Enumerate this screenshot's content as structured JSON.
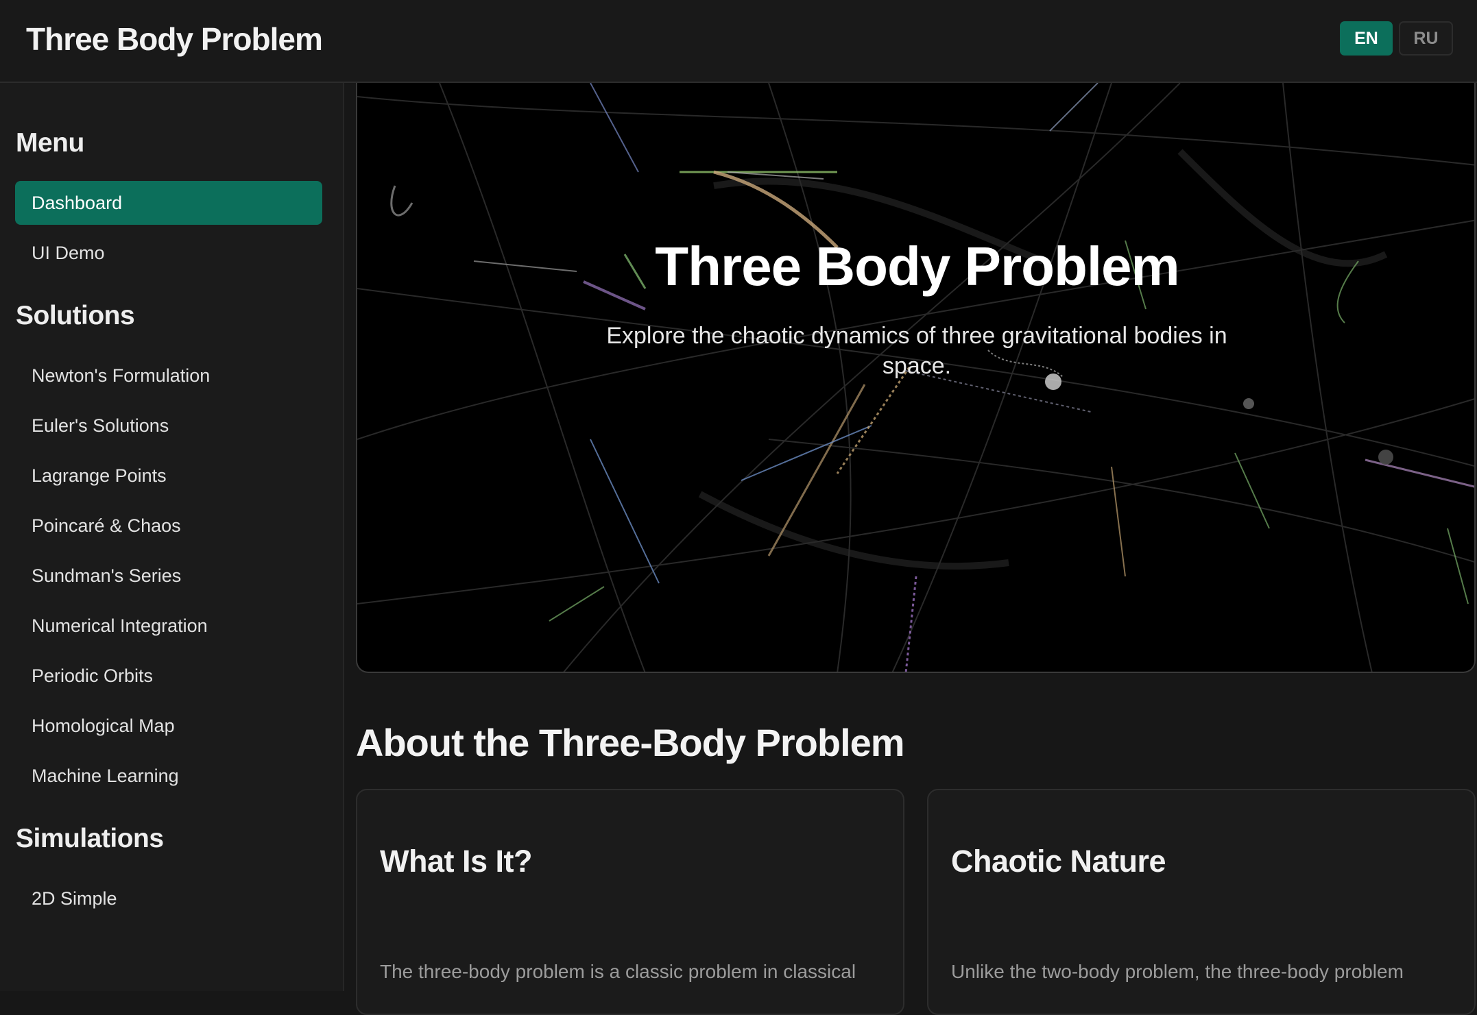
{
  "header": {
    "app_title": "Three Body Problem",
    "languages": [
      {
        "label": "EN",
        "active": true
      },
      {
        "label": "RU",
        "active": false
      }
    ]
  },
  "sidebar": {
    "menu_heading": "Menu",
    "menu_items": [
      {
        "label": "Dashboard",
        "active": true
      },
      {
        "label": "UI Demo",
        "active": false
      }
    ],
    "solutions_heading": "Solutions",
    "solutions_items": [
      {
        "label": "Newton's Formulation"
      },
      {
        "label": "Euler's Solutions"
      },
      {
        "label": "Lagrange Points"
      },
      {
        "label": "Poincaré & Chaos"
      },
      {
        "label": "Sundman's Series"
      },
      {
        "label": "Numerical Integration"
      },
      {
        "label": "Periodic Orbits"
      },
      {
        "label": "Homological Map"
      },
      {
        "label": "Machine Learning"
      }
    ],
    "simulations_heading": "Simulations",
    "simulations_items": [
      {
        "label": "2D Simple"
      }
    ]
  },
  "hero": {
    "title": "Three Body Problem",
    "subtitle": "Explore the chaotic dynamics of three gravitational bodies in space."
  },
  "about": {
    "title": "About the Three-Body Problem",
    "cards": [
      {
        "title": "What Is It?",
        "text": "The three-body problem is a classic problem in classical"
      },
      {
        "title": "Chaotic Nature",
        "text": "Unlike the two-body problem, the three-body problem"
      }
    ]
  },
  "colors": {
    "accent": "#0c6f5b",
    "background": "#171717",
    "sidebar": "#1b1b1b",
    "hero_background": "#000000"
  }
}
